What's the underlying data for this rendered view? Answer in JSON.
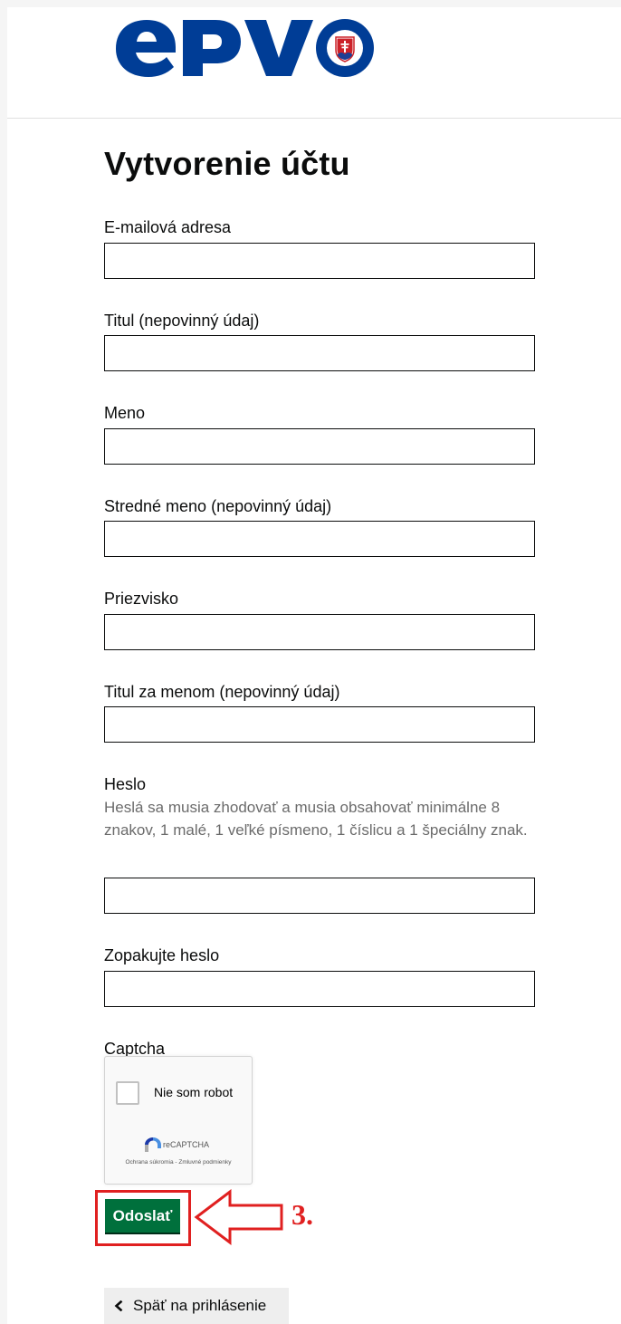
{
  "header": {
    "logo_text": "ePVO"
  },
  "form": {
    "title": "Vytvorenie účtu",
    "fields": [
      {
        "label": "E-mailová adresa",
        "value": ""
      },
      {
        "label": "Titul (nepovinný údaj)",
        "value": ""
      },
      {
        "label": "Meno",
        "value": ""
      },
      {
        "label": "Stredné meno (nepovinný údaj)",
        "value": ""
      },
      {
        "label": "Priezvisko",
        "value": ""
      },
      {
        "label": "Titul za menom (nepovinný údaj)",
        "value": ""
      },
      {
        "label": "Heslo",
        "hint": "Heslá sa musia zhodovať a musia obsahovať minimálne 8 znakov, 1 malé, 1 veľké písmeno, 1 číslicu a 1 špeciálny znak.",
        "value": ""
      },
      {
        "label": "Zopakujte heslo",
        "value": ""
      }
    ],
    "captcha": {
      "label": "Captcha",
      "checkbox_text": "Nie som robot",
      "brand": "reCAPTCHA",
      "links": "Ochrana súkromia - Zmluvné podmienky"
    },
    "submit_label": "Odoslať",
    "annotation": "3.",
    "back_label": "Späť na prihlásenie"
  },
  "colors": {
    "primary_green": "#00703c",
    "logo_blue": "#003d96",
    "annotation_red": "#e02020"
  }
}
